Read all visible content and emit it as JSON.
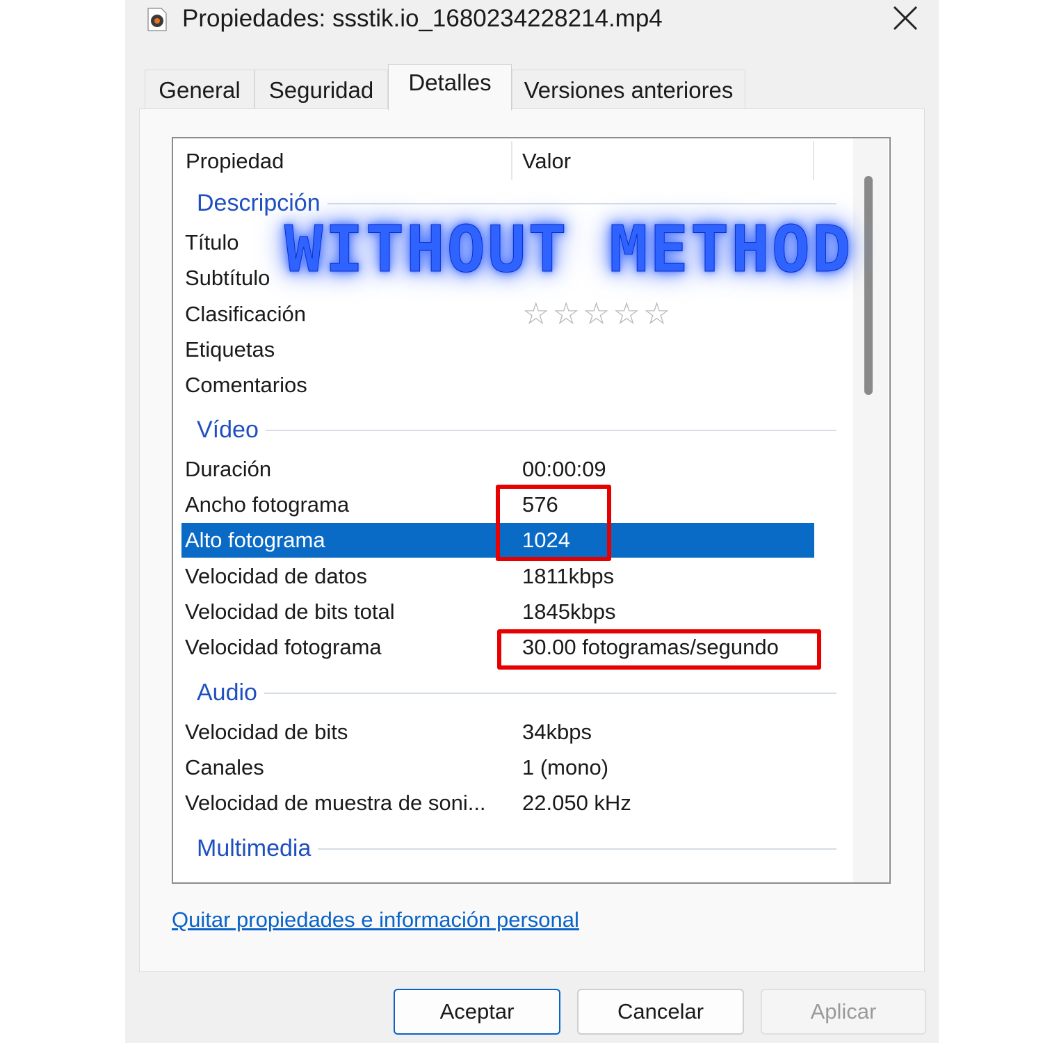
{
  "window": {
    "title": "Propiedades: ssstik.io_1680234228214.mp4"
  },
  "tabs": [
    "General",
    "Seguridad",
    "Detalles",
    "Versiones anteriores"
  ],
  "active_tab": "Detalles",
  "list": {
    "headers": {
      "property": "Propiedad",
      "value": "Valor"
    },
    "sections": {
      "description": "Descripción",
      "video": "Vídeo",
      "audio": "Audio",
      "multimedia": "Multimedia"
    },
    "rows": {
      "titulo": {
        "prop": "Título",
        "val": ""
      },
      "subtitulo": {
        "prop": "Subtítulo",
        "val": ""
      },
      "clasificacion": {
        "prop": "Clasificación",
        "stars": "☆☆☆☆☆",
        "rating": 0,
        "max": 5
      },
      "etiquetas": {
        "prop": "Etiquetas",
        "val": ""
      },
      "comentarios": {
        "prop": "Comentarios",
        "val": ""
      },
      "duracion": {
        "prop": "Duración",
        "val": "00:00:09"
      },
      "ancho": {
        "prop": "Ancho fotograma",
        "val": "576"
      },
      "alto": {
        "prop": "Alto fotograma",
        "val": "1024"
      },
      "vel_datos": {
        "prop": "Velocidad de datos",
        "val": "1811kbps"
      },
      "vel_bits_total": {
        "prop": "Velocidad de bits total",
        "val": "1845kbps"
      },
      "vel_fotograma": {
        "prop": "Velocidad fotograma",
        "val": "30.00 fotogramas/segundo"
      },
      "vel_bits": {
        "prop": "Velocidad de bits",
        "val": "34kbps"
      },
      "canales": {
        "prop": "Canales",
        "val": "1 (mono)"
      },
      "muestra": {
        "prop": "Velocidad de muestra de soni...",
        "val": "22.050 kHz"
      }
    },
    "selected_row": "Alto fotograma"
  },
  "overlay": {
    "watermark": "WITHOUT METHOD",
    "highlight_color": "#e60000"
  },
  "link": "Quitar propiedades e información personal",
  "buttons": {
    "ok": "Aceptar",
    "cancel": "Cancelar",
    "apply": "Aplicar"
  },
  "colors": {
    "selection": "#0a6bc6",
    "section_heading": "#1f4fbf",
    "link": "#0a63c7"
  }
}
